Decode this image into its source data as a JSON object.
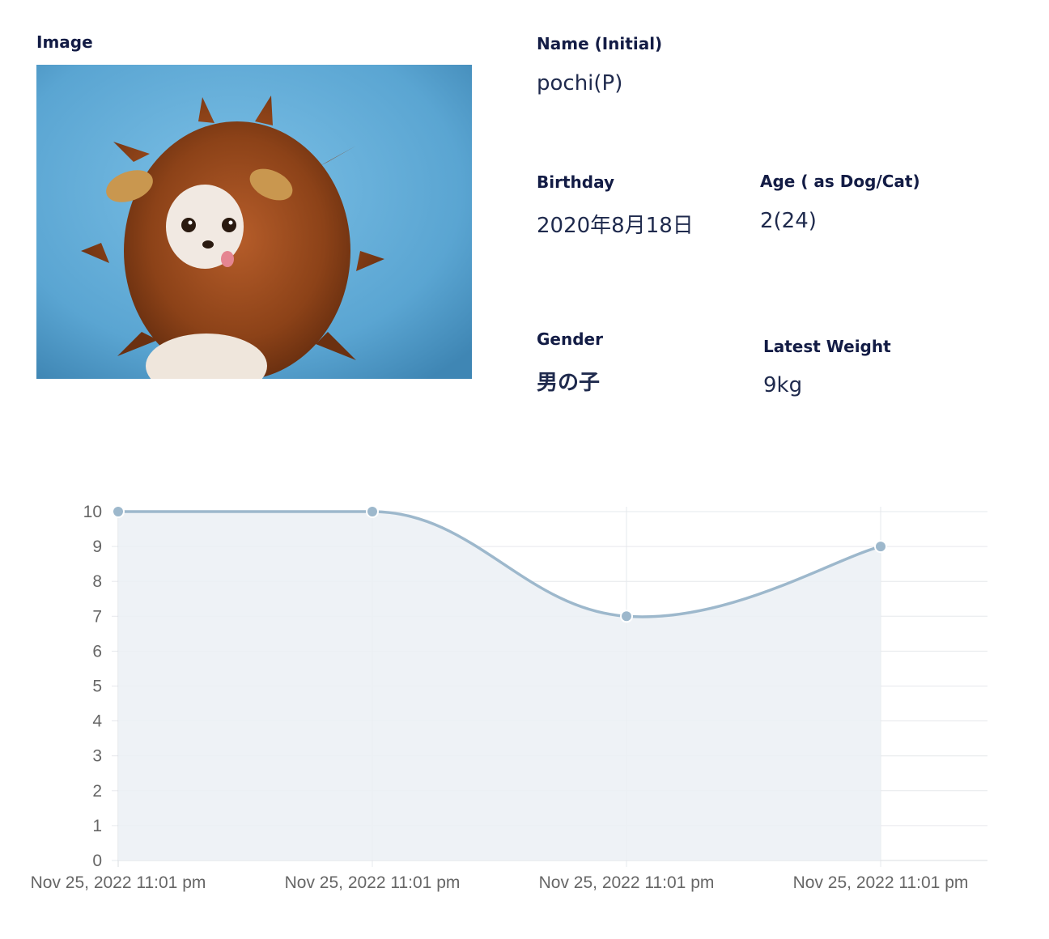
{
  "profile": {
    "image_label": "Image",
    "name_label": "Name (Initial)",
    "name_value": "pochi(P)",
    "birthday_label": "Birthday",
    "birthday_value": "2020年8月18日",
    "age_label": "Age ( as Dog/Cat)",
    "age_value": "2(24)",
    "gender_label": "Gender",
    "gender_value": "男の子",
    "weight_label": "Latest Weight",
    "weight_value": "9kg"
  },
  "colors": {
    "line": "#9db8cc",
    "fill": "#ebf0f5",
    "grid": "#e6e8ec",
    "tick_text": "#666666"
  },
  "chart_data": {
    "type": "area",
    "categories": [
      "Nov 25, 2022 11:01 pm",
      "Nov 25, 2022 11:01 pm",
      "Nov 25, 2022 11:01 pm",
      "Nov 25, 2022 11:01 pm"
    ],
    "series": [
      {
        "values": [
          10,
          10,
          7,
          9
        ]
      }
    ],
    "yticks": [
      "0",
      "1",
      "2",
      "3",
      "4",
      "5",
      "6",
      "7",
      "8",
      "9",
      "10"
    ],
    "ylim": [
      0,
      10
    ],
    "grid": true
  }
}
